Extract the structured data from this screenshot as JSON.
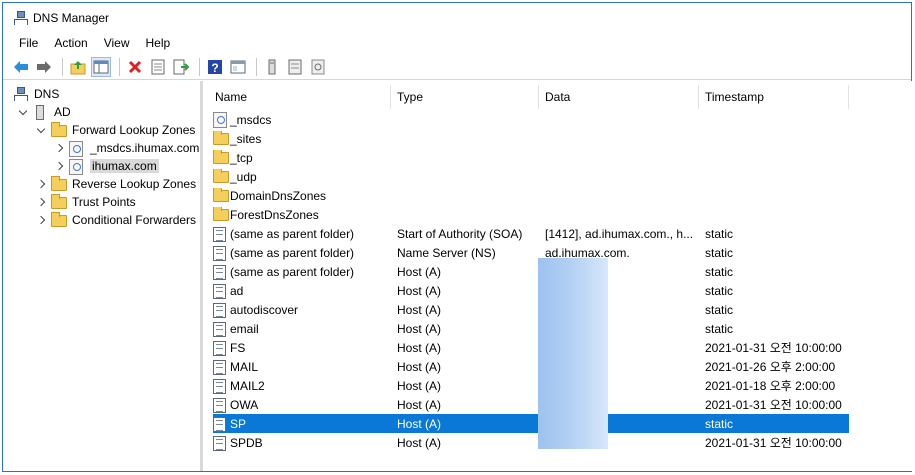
{
  "window": {
    "title": "DNS Manager"
  },
  "menu": [
    "File",
    "Action",
    "View",
    "Help"
  ],
  "toolbar": {
    "buttons": [
      "back-arrow-icon",
      "forward-arrow-icon",
      "up-folder-icon",
      "show-hide-tree-icon",
      "delete-icon",
      "properties-icon",
      "export-list-icon",
      "help-icon",
      "console-view-icon",
      "server-icon",
      "record-list-icon",
      "update-data-icon"
    ],
    "colors": {
      "back": "#2a8fd8",
      "forward": "#6a6a6a",
      "delete": "#e02020",
      "help": "#2545a8"
    }
  },
  "tree": {
    "items": [
      {
        "label": "DNS",
        "icon": "dns-network-icon",
        "expander": "none"
      },
      {
        "label": "AD",
        "icon": "server-icon",
        "expander": "expanded"
      },
      {
        "label": "Forward Lookup Zones",
        "icon": "folder-icon",
        "expander": "expanded"
      },
      {
        "label": "_msdcs.ihumax.com",
        "icon": "zone-icon",
        "expander": "collapsed"
      },
      {
        "label": "ihumax.com",
        "icon": "zone-icon",
        "expander": "collapsed",
        "selected": true
      },
      {
        "label": "Reverse Lookup Zones",
        "icon": "folder-icon",
        "expander": "collapsed"
      },
      {
        "label": "Trust Points",
        "icon": "folder-icon",
        "expander": "collapsed"
      },
      {
        "label": "Conditional Forwarders",
        "icon": "folder-icon",
        "expander": "collapsed"
      }
    ]
  },
  "list": {
    "columns": [
      "Name",
      "Type",
      "Data",
      "Timestamp"
    ],
    "rows": [
      {
        "name": "_msdcs",
        "type": "",
        "data": "",
        "timestamp": "",
        "icon": "zone-icon"
      },
      {
        "name": "_sites",
        "type": "",
        "data": "",
        "timestamp": "",
        "icon": "folder-icon"
      },
      {
        "name": "_tcp",
        "type": "",
        "data": "",
        "timestamp": "",
        "icon": "folder-icon"
      },
      {
        "name": "_udp",
        "type": "",
        "data": "",
        "timestamp": "",
        "icon": "folder-icon"
      },
      {
        "name": "DomainDnsZones",
        "type": "",
        "data": "",
        "timestamp": "",
        "icon": "folder-icon"
      },
      {
        "name": "ForestDnsZones",
        "type": "",
        "data": "",
        "timestamp": "",
        "icon": "folder-icon"
      },
      {
        "name": "(same as parent folder)",
        "type": "Start of Authority (SOA)",
        "data": "[1412], ad.ihumax.com., h...",
        "timestamp": "static",
        "icon": "record-icon"
      },
      {
        "name": "(same as parent folder)",
        "type": "Name Server (NS)",
        "data": "ad.ihumax.com.",
        "timestamp": "static",
        "icon": "record-icon"
      },
      {
        "name": "(same as parent folder)",
        "type": "Host (A)",
        "data": "",
        "timestamp": "static",
        "icon": "record-icon"
      },
      {
        "name": "ad",
        "type": "Host (A)",
        "data": "",
        "timestamp": "static",
        "icon": "record-icon"
      },
      {
        "name": "autodiscover",
        "type": "Host (A)",
        "data": "",
        "timestamp": "static",
        "icon": "record-icon"
      },
      {
        "name": "email",
        "type": "Host (A)",
        "data": "",
        "timestamp": "static",
        "icon": "record-icon"
      },
      {
        "name": "FS",
        "type": "Host (A)",
        "data": "",
        "timestamp": "2021-01-31 오전 10:00:00",
        "icon": "record-icon"
      },
      {
        "name": "MAIL",
        "type": "Host (A)",
        "data": "",
        "timestamp": "2021-01-26 오후 2:00:00",
        "icon": "record-icon"
      },
      {
        "name": "MAIL2",
        "type": "Host (A)",
        "data": "",
        "timestamp": "2021-01-18 오후 2:00:00",
        "icon": "record-icon"
      },
      {
        "name": "OWA",
        "type": "Host (A)",
        "data": "",
        "timestamp": "2021-01-31 오전 10:00:00",
        "icon": "record-icon"
      },
      {
        "name": "SP",
        "type": "Host (A)",
        "data": "",
        "timestamp": "static",
        "icon": "record-icon",
        "selected": true
      },
      {
        "name": "SPDB",
        "type": "Host (A)",
        "data": "",
        "timestamp": "2021-01-31 오전 10:00:00",
        "icon": "record-icon"
      }
    ],
    "selected_color": "#0a78d7"
  }
}
